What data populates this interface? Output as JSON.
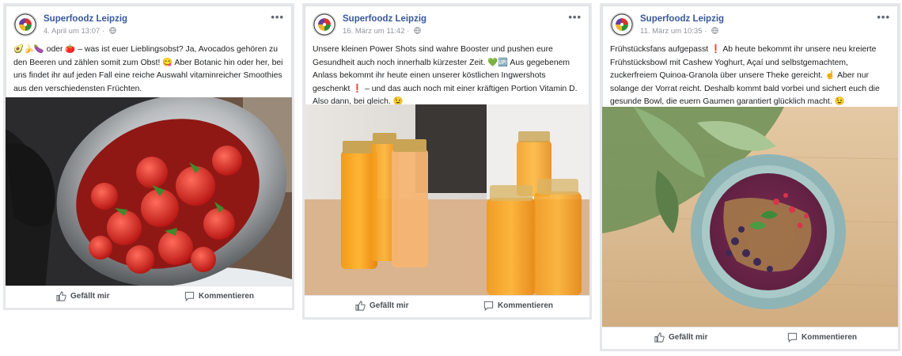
{
  "page_name": "Superfoodz Leipzig",
  "actions": {
    "like_label": "Gefällt mir",
    "comment_label": "Kommentieren"
  },
  "colors": {
    "link_blue": "#385898",
    "meta_grey": "#90949c",
    "action_grey": "#4b4f56"
  },
  "icons": {
    "avatar": "superfoodz-logo-icon",
    "privacy": "globe-icon",
    "menu": "more-options-icon",
    "like": "thumbs-up-icon",
    "comment": "comment-bubble-icon"
  },
  "posts": [
    {
      "timestamp": "4. April um 13:07 ·",
      "text": "🥑🍌🍆 oder 🍅 – was ist euer Lieblingsobst? Ja, Avocados gehören zu den Beeren und zählen somit zum Obst! 😋 Aber Botanic hin oder her, bei uns findet ihr auf jeden Fall eine reiche Auswahl vitaminreicher Smoothies aus den verschiedensten Früchten.",
      "image": "strawberries-in-steel-bowl-photo"
    },
    {
      "timestamp": "16. März um 11:42 ·",
      "text": "Unsere kleinen Power Shots sind wahre Booster und pushen eure Gesundheit auch noch innerhalb kürzester Zeit. 💚🆙 Aus gegebenem Anlass bekommt ihr heute einen unserer köstlichen Ingwershots geschenkt ❗ – und das auch noch mit einer kräftigen Portion Vitamin D. Also dann, bei gleich. 😉",
      "image": "ginger-shot-bottles-photo"
    },
    {
      "timestamp": "11. März um 10:35 ·",
      "text": "Frühstücksfans aufgepasst ❗ Ab heute bekommt ihr unsere neu kreierte Frühstücksbowl mit Cashew Yoghurt, Açaí und selbstgemachtem, zuckerfreiem Quinoa-Granola über unsere Theke gereicht. ☝ Aber nur solange der Vorrat reicht. Deshalb kommt bald vorbei und sichert euch die gesunde Bowl, die euern Gaumen garantiert glücklich macht. 😉",
      "image": "acai-breakfast-bowl-photo"
    }
  ]
}
